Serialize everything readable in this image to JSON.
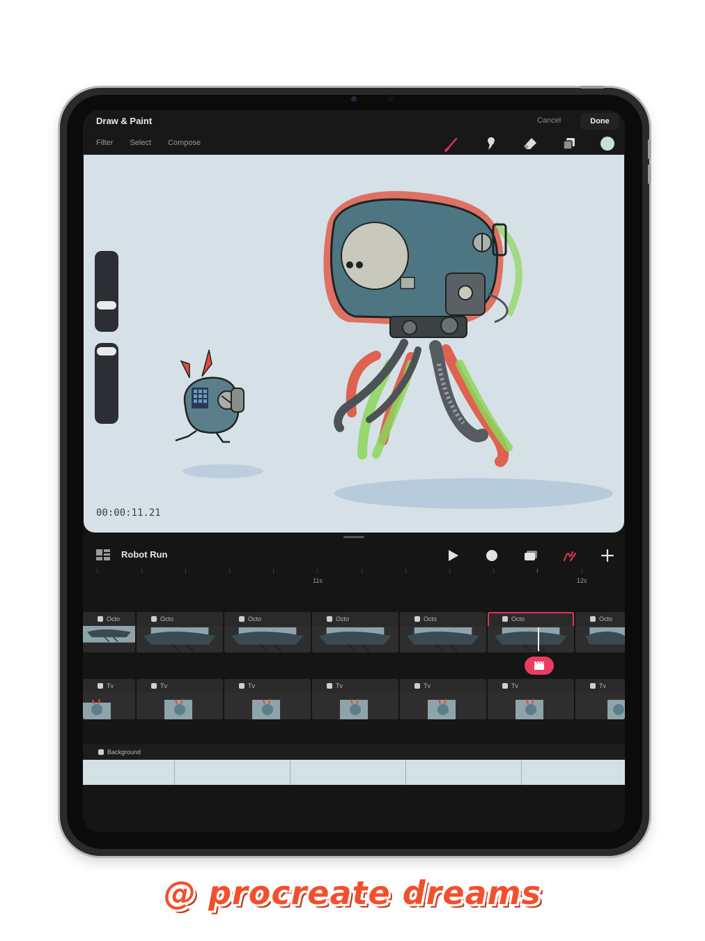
{
  "header": {
    "title": "Draw & Paint",
    "menu": [
      "Filter",
      "Select",
      "Compose"
    ],
    "cancel_label": "Cancel",
    "done_label": "Done"
  },
  "tools": {
    "items": [
      "brush-icon",
      "smudge-icon",
      "eraser-icon",
      "layers-icon"
    ],
    "active": "brush-icon",
    "active_color": "#e0335a",
    "current_color": "#bfe3d6"
  },
  "canvas": {
    "timecode": "00:00:11.21",
    "background_color": "#d5e1e6",
    "brush_size_level": 0.3,
    "opacity_level": 0.9
  },
  "timeline": {
    "project_name": "Robot Run",
    "controls": [
      "play-icon",
      "record-icon",
      "flipbook-icon",
      "draw-mode-icon",
      "add-icon"
    ],
    "ruler_labels": [
      "11s",
      "12s"
    ],
    "tracks": [
      {
        "name": "Octo",
        "clip_labels": [
          "Octo",
          "Octo",
          "Octo",
          "Octo",
          "Octo",
          "Octo",
          "Octo"
        ],
        "selected_index": 5
      },
      {
        "name": "Tv",
        "clip_labels": [
          "Tv",
          "Tv",
          "Tv",
          "Tv",
          "Tv",
          "Tv",
          "Tv"
        ]
      }
    ],
    "background_track": "Background"
  },
  "watermark": "@ procreate dreams"
}
